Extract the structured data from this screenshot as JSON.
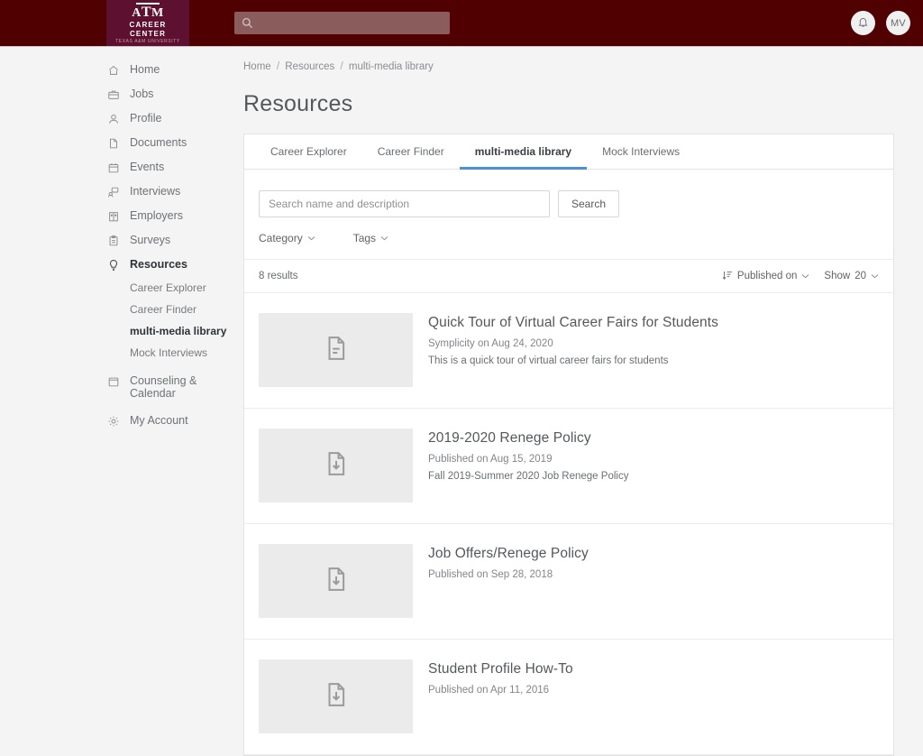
{
  "theme": {
    "header_bg": "#500000",
    "logo_bg": "#5e1030",
    "header_search_bg": "#8a5c5c",
    "accent_blue": "#4a90d9",
    "page_bg": "#f4f4f4",
    "card_bg": "#ffffff"
  },
  "header": {
    "logo": {
      "mark": "A|M",
      "line1": "CAREER",
      "line2": "CENTER",
      "subtext": "TEXAS A&M UNIVERSITY",
      "icon": "texas-am-logo"
    },
    "search": {
      "value": "",
      "placeholder": "",
      "icon": "search-icon"
    },
    "notifications": {
      "icon": "bell-icon",
      "label": ""
    },
    "avatar": {
      "initials": "MV"
    }
  },
  "sidebar": {
    "items": [
      {
        "label": "Home",
        "icon": "home-icon",
        "active": false
      },
      {
        "label": "Jobs",
        "icon": "briefcase-icon",
        "active": false
      },
      {
        "label": "Profile",
        "icon": "user-icon",
        "active": false
      },
      {
        "label": "Documents",
        "icon": "document-icon",
        "active": false
      },
      {
        "label": "Events",
        "icon": "calendar-icon",
        "active": false
      },
      {
        "label": "Interviews",
        "icon": "interview-icon",
        "active": false
      },
      {
        "label": "Employers",
        "icon": "building-icon",
        "active": false
      },
      {
        "label": "Surveys",
        "icon": "clipboard-icon",
        "active": false
      },
      {
        "label": "Resources",
        "icon": "lightbulb-icon",
        "active": true
      }
    ],
    "subitems": [
      {
        "label": "Career Explorer",
        "active": false
      },
      {
        "label": "Career Finder",
        "active": false
      },
      {
        "label": "multi-media library",
        "active": true
      },
      {
        "label": "Mock Interviews",
        "active": false
      }
    ],
    "items_after": [
      {
        "label": "Counseling & Calendar",
        "icon": "calendar-outline-icon",
        "active": false
      },
      {
        "label": "My Account",
        "icon": "gear-icon",
        "active": false
      }
    ]
  },
  "breadcrumb": {
    "items": [
      "Home",
      "Resources",
      "multi-media library"
    ],
    "separator": "/"
  },
  "page": {
    "title": "Resources"
  },
  "tabs": [
    {
      "label": "Career Explorer",
      "active": false
    },
    {
      "label": "Career Finder",
      "active": false
    },
    {
      "label": "multi-media library",
      "active": true
    },
    {
      "label": "Mock Interviews",
      "active": false
    }
  ],
  "search": {
    "placeholder": "Search name and description",
    "value": "",
    "button_label": "Search"
  },
  "filters": [
    {
      "label": "Category",
      "icon": "chevron-down-icon"
    },
    {
      "label": "Tags",
      "icon": "chevron-down-icon"
    }
  ],
  "results_bar": {
    "count_label": "8 results",
    "sort_icon": "sort-descending-icon",
    "sort_label": "Published on",
    "show_label": "Show",
    "show_value": "20"
  },
  "results": [
    {
      "title": "Quick Tour of Virtual Career Fairs for Students",
      "meta": "Symplicity on Aug 24, 2020",
      "description": "This is a quick tour of virtual career fairs for students",
      "thumb_icon": "file-text-icon"
    },
    {
      "title": "2019-2020 Renege Policy",
      "meta": "Published on Aug 15, 2019",
      "description": "Fall 2019-Summer 2020 Job Renege Policy",
      "thumb_icon": "file-download-icon"
    },
    {
      "title": "Job Offers/Renege Policy",
      "meta": "Published on Sep 28, 2018",
      "description": "",
      "thumb_icon": "file-download-icon"
    },
    {
      "title": "Student Profile How-To",
      "meta": "Published on Apr 11, 2016",
      "description": "",
      "thumb_icon": "file-download-icon"
    }
  ]
}
